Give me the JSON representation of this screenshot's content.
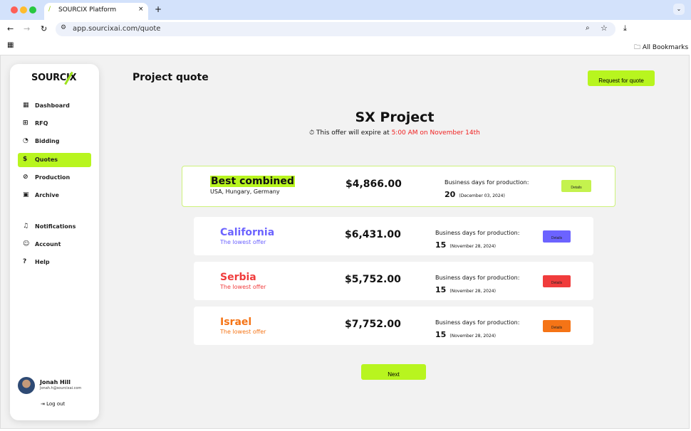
{
  "browser": {
    "tab_title": "SOURCIX Platform",
    "url": "app.sourcixai.com/quote",
    "bookmarks": "All Bookmarks"
  },
  "sidebar": {
    "logo": "SOURCIX",
    "items": [
      {
        "label": "Dashboard",
        "icon": "grid-icon"
      },
      {
        "label": "RFQ",
        "icon": "file-plus-icon"
      },
      {
        "label": "Bidding",
        "icon": "clock-icon"
      },
      {
        "label": "Quotes",
        "icon": "dollar-file-icon",
        "active": true
      },
      {
        "label": "Production",
        "icon": "wrench-icon"
      },
      {
        "label": "Archive",
        "icon": "archive-icon"
      },
      {
        "label": "Notifications",
        "icon": "bell-icon"
      },
      {
        "label": "Account",
        "icon": "user-icon"
      },
      {
        "label": "Help",
        "icon": "help-icon"
      }
    ],
    "user": {
      "name": "Jonah Hill",
      "email": "Jonah.h@sourcixai.com"
    },
    "logout": "Log out"
  },
  "header": {
    "title": "Project quote",
    "request_button": "Request for quote"
  },
  "project": {
    "name": "SX Project",
    "offer_prefix": "This offer will expire at",
    "offer_time": "5:00 AM on November 14th"
  },
  "best": {
    "name": "Best combined",
    "countries": "USA, Hungary, Germany",
    "price": "$4,866.00",
    "days_label": "Business days for production:",
    "days": "20",
    "date": "(December 03, 2024)",
    "details": "Details",
    "color": "#c4f24e"
  },
  "quotes": [
    {
      "name": "California",
      "sub": "The lowest offer",
      "price": "$6,431.00",
      "days_label": "Business days for production:",
      "days": "15",
      "date": "(November 28, 2024)",
      "details": "Details",
      "color": "#6c63ff"
    },
    {
      "name": "Serbia",
      "sub": "The lowest offer",
      "price": "$5,752.00",
      "days_label": "Business days for production:",
      "days": "15",
      "date": "(November 28, 2024)",
      "details": "Details",
      "color": "#f03c3c"
    },
    {
      "name": "Israel",
      "sub": "The lowest offer",
      "price": "$7,752.00",
      "days_label": "Business days for production:",
      "days": "15",
      "date": "(November 28, 2024)",
      "details": "Details",
      "color": "#f57416"
    }
  ],
  "next_button": "Next",
  "accent": "#b8f51f"
}
